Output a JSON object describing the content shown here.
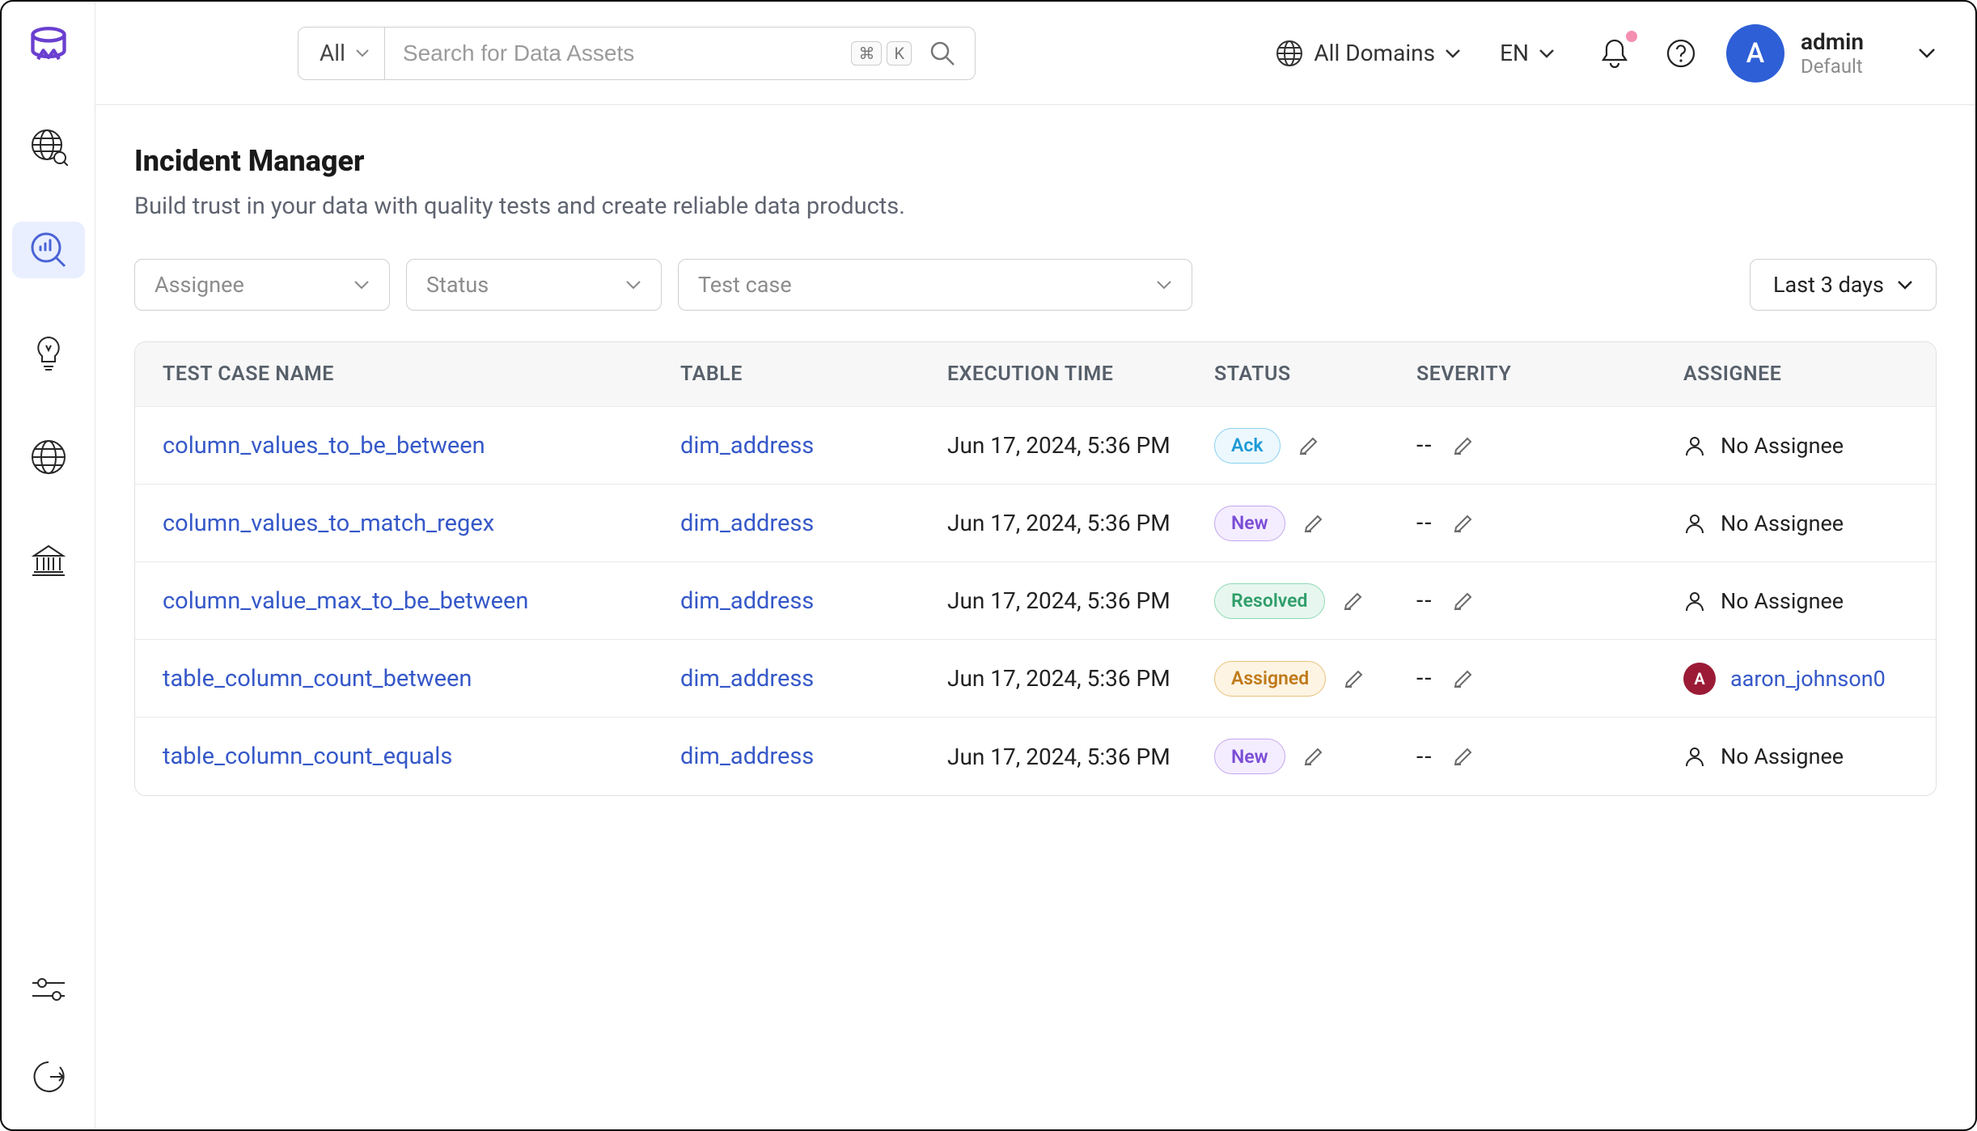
{
  "header": {
    "search_scope_label": "All",
    "search_placeholder": "Search for Data Assets",
    "kbd1": "⌘",
    "kbd2": "K",
    "domain_label": "All Domains",
    "lang_label": "EN",
    "user_name": "admin",
    "user_team": "Default",
    "user_initial": "A"
  },
  "page": {
    "title": "Incident Manager",
    "subtitle": "Build trust in your data with quality tests and create reliable data products."
  },
  "filters": {
    "assignee_placeholder": "Assignee",
    "status_placeholder": "Status",
    "testcase_placeholder": "Test case",
    "time_range_label": "Last 3 days"
  },
  "table": {
    "columns": {
      "name": "TEST CASE NAME",
      "table": "TABLE",
      "exec": "EXECUTION TIME",
      "status": "STATUS",
      "severity": "SEVERITY",
      "assignee": "ASSIGNEE"
    },
    "no_assignee_label": "No Assignee",
    "severity_placeholder": "--",
    "rows": [
      {
        "name": "column_values_to_be_between",
        "table": "dim_address",
        "exec": "Jun 17, 2024, 5:36 PM",
        "status_label": "Ack",
        "status_class": "badge-ack",
        "assignee_type": "none"
      },
      {
        "name": "column_values_to_match_regex",
        "table": "dim_address",
        "exec": "Jun 17, 2024, 5:36 PM",
        "status_label": "New",
        "status_class": "badge-new",
        "assignee_type": "none"
      },
      {
        "name": "column_value_max_to_be_between",
        "table": "dim_address",
        "exec": "Jun 17, 2024, 5:36 PM",
        "status_label": "Resolved",
        "status_class": "badge-resolved",
        "assignee_type": "none"
      },
      {
        "name": "table_column_count_between",
        "table": "dim_address",
        "exec": "Jun 17, 2024, 5:36 PM",
        "status_label": "Assigned",
        "status_class": "badge-assigned",
        "assignee_type": "user",
        "assignee_name": "aaron_johnson0",
        "assignee_initial": "A"
      },
      {
        "name": "table_column_count_equals",
        "table": "dim_address",
        "exec": "Jun 17, 2024, 5:36 PM",
        "status_label": "New",
        "status_class": "badge-new",
        "assignee_type": "none"
      }
    ]
  }
}
